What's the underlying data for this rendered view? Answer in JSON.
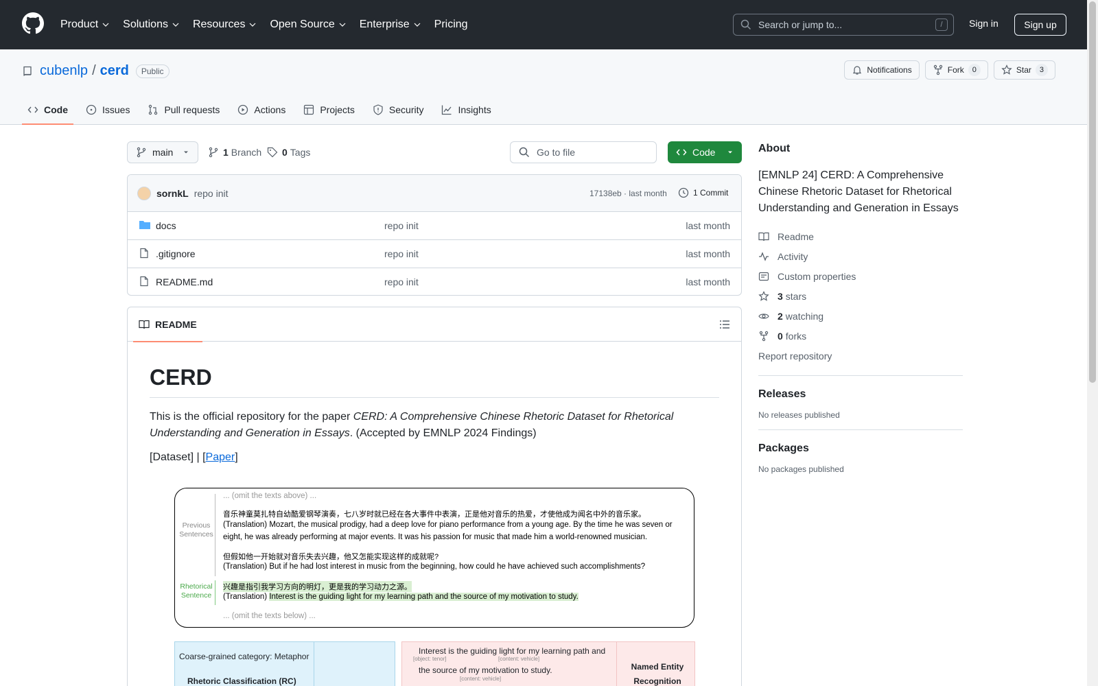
{
  "header": {
    "nav": [
      "Product",
      "Solutions",
      "Resources",
      "Open Source",
      "Enterprise",
      "Pricing"
    ],
    "search_placeholder": "Search or jump to...",
    "search_shortcut": "/",
    "signin": "Sign in",
    "signup": "Sign up"
  },
  "repo": {
    "owner": "cubenlp",
    "separator": "/",
    "name": "cerd",
    "visibility": "Public",
    "notifications": "Notifications",
    "fork_label": "Fork",
    "fork_count": "0",
    "star_label": "Star",
    "star_count": "3"
  },
  "tabs": [
    "Code",
    "Issues",
    "Pull requests",
    "Actions",
    "Projects",
    "Security",
    "Insights"
  ],
  "branchbar": {
    "branch": "main",
    "branch_count": "1",
    "branch_word": "Branch",
    "tag_count": "0",
    "tag_word": "Tags",
    "goto_placeholder": "Go to file",
    "code_button": "Code"
  },
  "commit": {
    "author": "sornkL",
    "message": "repo init",
    "hash_time": "17138eb · last month",
    "count": "1 Commit"
  },
  "files": [
    {
      "name": "docs",
      "type": "folder",
      "message": "repo init",
      "date": "last month"
    },
    {
      "name": ".gitignore",
      "type": "file",
      "message": "repo init",
      "date": "last month"
    },
    {
      "name": "README.md",
      "type": "file",
      "message": "repo init",
      "date": "last month"
    }
  ],
  "readme": {
    "tab": "README",
    "title": "CERD",
    "intro_pre": "This is the official repository for the paper ",
    "intro_em": "CERD: A Comprehensive Chinese Rhetoric Dataset for Rhetorical Understanding and Generation in Essays",
    "intro_post": ". (Accepted by EMNLP 2024 Findings)",
    "links_pre": "[Dataset] | [",
    "links_paper": "Paper",
    "links_post": "]",
    "figure": {
      "omit_above": "... (omit the texts above) ...",
      "omit_below": "... (omit the texts below) ...",
      "prev_label": "Previous Sentences",
      "rhet_label": "Rhetorical Sentence",
      "zh1": "音乐神童莫扎特自幼酷爱钢琴演奏，七八岁时就已经在各大事件中表演，正是他对音乐的热爱，才使他成为闻名中外的音乐家。",
      "en1": "(Translation) Mozart, the musical prodigy, had a deep love for piano performance from a young age. By the time he was seven or eight, he was already performing at major events. It was his passion for music that made him a world-renowned musician.",
      "zh2": "但假如他一开始就对音乐失去兴趣，他又怎能实现这样的成就呢?",
      "en2": "(Translation) But if he had lost interest in music from the beginning, how could he have achieved such accomplishments?",
      "zh3": "兴趣是指引我学习方向的明灯，更是我的学习动力之源。",
      "en3_pre": "(Translation) ",
      "en3_hl": "Interest is the guiding light for my learning path and the source of my motivation to study.",
      "rc_category": "Coarse-grained category: Metaphor",
      "rc_title": "Rhetoric Classification (RC)",
      "ner_line1": "Interest is the guiding light for my learning path and",
      "ner_line2": "the source of my motivation to study.",
      "ner_tag1": "[object: tenor]",
      "ner_tag2": "[content: vehicle]",
      "ner_tag3": "[content: vehicle]",
      "ner_title": "Named Entity Recognition"
    }
  },
  "about": {
    "title": "About",
    "description": "[EMNLP 24] CERD: A Comprehensive Chinese Rhetoric Dataset for Rhetorical Understanding and Generation in Essays",
    "readme": "Readme",
    "activity": "Activity",
    "custom": "Custom properties",
    "stars_count": "3",
    "stars_word": "stars",
    "watching_count": "2",
    "watching_word": "watching",
    "forks_count": "0",
    "forks_word": "forks",
    "report": "Report repository",
    "releases_title": "Releases",
    "releases_text": "No releases published",
    "packages_title": "Packages",
    "packages_text": "No packages published"
  }
}
